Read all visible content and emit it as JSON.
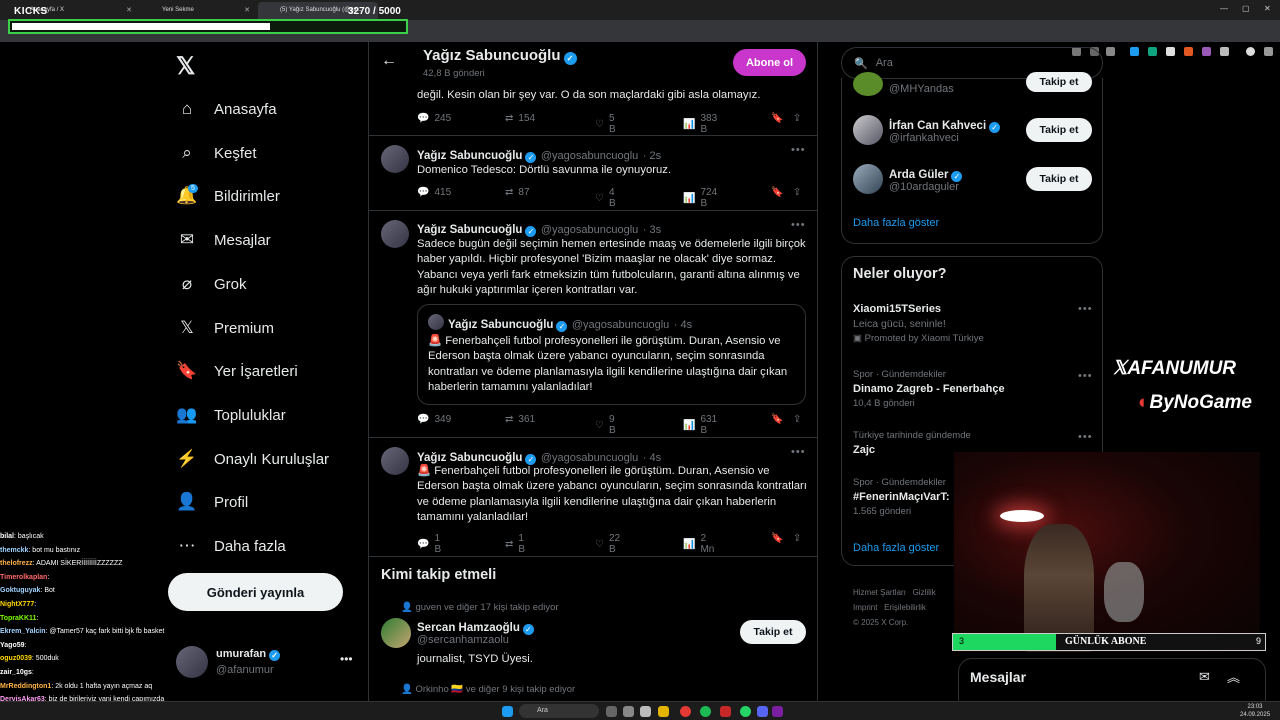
{
  "browser": {
    "tabs": [
      {
        "title": "Anasayfa / X"
      },
      {
        "title": "Yeni Sekme"
      },
      {
        "title": "(5) Yağız Sabuncuoğlu (@ya..."
      }
    ]
  },
  "kicks": {
    "label": "KICKS",
    "current": "3270",
    "goal": "/ 5000",
    "progress": 0.654
  },
  "nav": {
    "items": [
      {
        "label": "Anasayfa"
      },
      {
        "label": "Keşfet"
      },
      {
        "label": "Bildirimler",
        "badge": "5"
      },
      {
        "label": "Mesajlar"
      },
      {
        "label": "Grok"
      },
      {
        "label": "Premium"
      },
      {
        "label": "Yer İşaretleri"
      },
      {
        "label": "Topluluklar"
      },
      {
        "label": "Onaylı Kuruluşlar"
      },
      {
        "label": "Profil"
      },
      {
        "label": "Daha fazla"
      }
    ],
    "post_button": "Gönderi yayınla",
    "user": {
      "name": "umurafan",
      "handle": "@afanumur"
    }
  },
  "chat": [
    {
      "user": "bilal",
      "msg": ": başlıcak",
      "color": "#ffffff"
    },
    {
      "user": "themckk",
      "msg": ": bot mu bastınız",
      "color": "#9fd3ff"
    },
    {
      "user": "thelofrezz",
      "msg": ": ADAMI SİKERİİİİİİİİZZZZZZ",
      "color": "#ffb347"
    },
    {
      "user": "Timerolkaplan",
      "msg": ":",
      "color": "#ff6b6b"
    },
    {
      "user": "Goktuguyak",
      "msg": ": Bot",
      "color": "#9fd3ff"
    },
    {
      "user": "NightX777",
      "msg": ":",
      "color": "#ffd700"
    },
    {
      "user": "TopraKK11",
      "msg": ":",
      "color": "#7cfc00"
    },
    {
      "user": "Ekrem_Yalcin",
      "msg": ": @Tamer57 kaç fark bitti bjk fb basket",
      "color": "#9fd3ff"
    },
    {
      "user": "Yago59",
      "msg": ":",
      "color": "#ffffff"
    },
    {
      "user": "oguz0039",
      "msg": ": 500duk",
      "color": "#ffd700"
    },
    {
      "user": "zair_10gs",
      "msg": ":",
      "color": "#ffffff"
    },
    {
      "user": "MrReddington1",
      "msg": ": 2k oldu 1 hafta yayın açmaz aq",
      "color": "#ffb347"
    },
    {
      "user": "DervisAkar63",
      "msg": ": biz de birileriyiz yani kendi çapımızda",
      "color": "#ff9ff3"
    }
  ],
  "profile_header": {
    "name": "Yağız Sabuncuoğlu",
    "posts": "42,8 B gönderi",
    "subscribe": "Abone ol"
  },
  "tweets": [
    {
      "text": "değil. Kesin olan bir şey var. O da son maçlardaki gibi asla olamayız.",
      "replies": "245",
      "retweets": "154",
      "likes": "5 B",
      "views": "383 B"
    },
    {
      "name": "Yağız Sabuncuoğlu",
      "handle": "@yagosabuncuoglu",
      "time": "· 2s",
      "text": "Domenico Tedesco: Dörtlü savunma ile oynuyoruz.",
      "replies": "415",
      "retweets": "87",
      "likes": "4 B",
      "views": "724 B"
    },
    {
      "name": "Yağız Sabuncuoğlu",
      "handle": "@yagosabuncuoglu",
      "time": "· 3s",
      "text": "Sadece bugün değil seçimin hemen ertesinde maaş ve ödemelerle ilgili birçok haber yapıldı. Hiçbir profesyonel 'Bizim maaşlar ne olacak' diye sormaz. Yabancı veya yerli fark etmeksizin tüm futbolcuların, garanti altına alınmış ve ağır hukuki yaptırımlar içeren kontratları var.",
      "quote": {
        "name": "Yağız Sabuncuoğlu",
        "handle": "@yagosabuncuoglu",
        "time": "· 4s",
        "text": "🚨 Fenerbahçeli futbol profesyonelleri ile görüştüm. Duran, Asensio ve Ederson başta olmak üzere yabancı oyuncuların, seçim sonrasında kontratları ve ödeme planlamasıyla ilgili kendilerine ulaştığına dair çıkan haberlerin tamamını yalanladılar!"
      },
      "replies": "349",
      "retweets": "361",
      "likes": "9 B",
      "views": "631 B"
    },
    {
      "name": "Yağız Sabuncuoğlu",
      "handle": "@yagosabuncuoglu",
      "time": "· 4s",
      "text": "🚨 Fenerbahçeli futbol profesyonelleri ile görüştüm. Duran, Asensio ve Ederson başta olmak üzere yabancı oyuncuların, seçim sonrasında kontratları ve ödeme planlamasıyla ilgili kendilerine ulaştığına dair çıkan haberlerin tamamını yalanladılar!",
      "replies": "1 B",
      "retweets": "1 B",
      "likes": "22 B",
      "views": "2 Mn"
    }
  ],
  "who_to_follow": {
    "title": "Kimi takip etmeli",
    "items": [
      {
        "context": "guven ve diğer 17 kişi takip ediyor",
        "name": "Sercan Hamzaoğlu",
        "handle": "@sercanhamzaolu",
        "bio": "journalist, TSYD Üyesi.",
        "button": "Takip et"
      },
      {
        "context": "Orkinho 🇨🇴 ve diğer 9 kişi takip ediyor"
      }
    ]
  },
  "right": {
    "search_placeholder": "Ara",
    "suggestions": [
      {
        "name": "",
        "handle": "@MHYandas",
        "button": "Takip et"
      },
      {
        "name": "İrfan Can Kahveci",
        "handle": "@irfankahveci",
        "button": "Takip et"
      },
      {
        "name": "Arda Güler",
        "handle": "@10ardaguler",
        "button": "Takip et"
      }
    ],
    "show_more": "Daha fazla göster",
    "trends_title": "Neler oluyor?",
    "trends": [
      {
        "meta": "",
        "title": "Xiaomi15TSeries",
        "sub": "Leica gücü, seninle!",
        "extra": "Promoted by Xiaomi Türkiye"
      },
      {
        "meta": "Spor · Gündemdekiler",
        "title": "Dinamo Zagreb - Fenerbahçe",
        "sub": "10,4 B gönderi"
      },
      {
        "meta": "Türkiye tarihinde gündemde",
        "title": "Zajc",
        "sub": ""
      },
      {
        "meta": "Spor · Gündemdekiler",
        "title": "#FenerinMaçıVarT:",
        "sub": "1.565 gönderi"
      }
    ],
    "trends_more": "Daha fazla göster",
    "footer": [
      "Hizmet Şartları",
      "Gizlilik",
      "Imprint",
      "Erişilebilirlik",
      "© 2025 X Corp."
    ]
  },
  "overlay": {
    "brand1": "AFANUMUR",
    "brand2": "ByNoGame",
    "abone_label": "GÜNLÜK ABONE",
    "abone_left": "3",
    "abone_right": "9",
    "abone_progress": 0.33,
    "messages": "Mesajlar"
  },
  "taskbar": {
    "search": "Ara",
    "time": "23:03",
    "date": "24.09.2025"
  }
}
